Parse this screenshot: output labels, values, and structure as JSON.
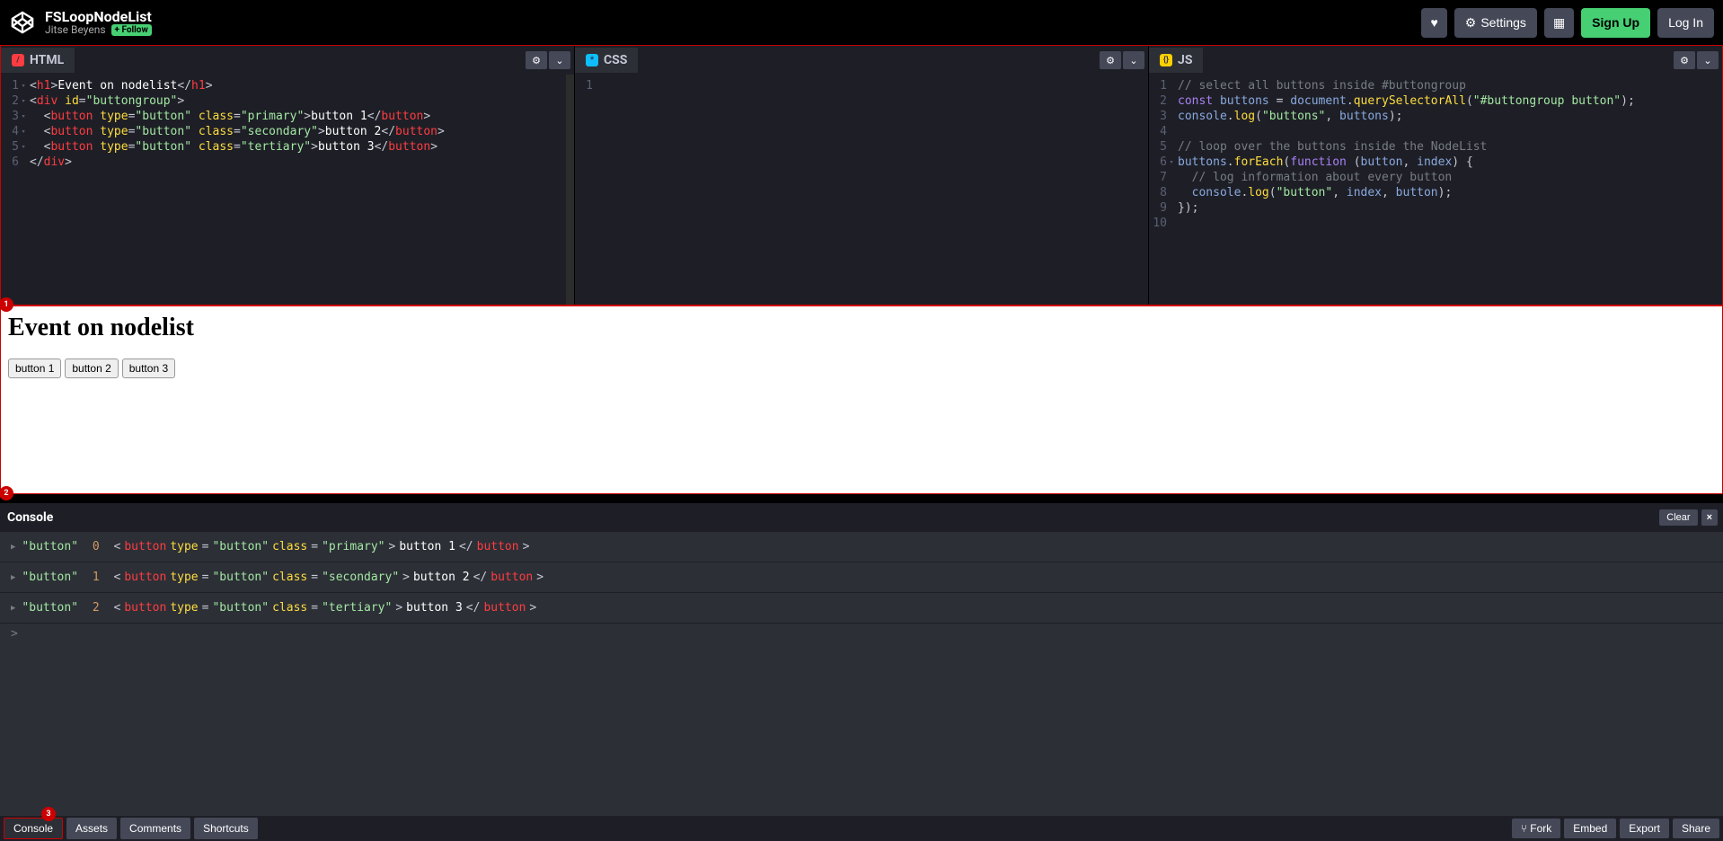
{
  "header": {
    "title": "FSLoopNodeList",
    "author": "Jitse Beyens",
    "follow": "+ Follow",
    "settings": "Settings",
    "signup": "Sign Up",
    "login": "Log In"
  },
  "panes": {
    "html": {
      "label": "HTML"
    },
    "css": {
      "label": "CSS"
    },
    "js": {
      "label": "JS"
    }
  },
  "html_code": {
    "l1": {
      "a": "<",
      "b": "h1",
      "c": ">",
      "d": "Event on nodelist",
      "e": "</",
      "f": "h1",
      "g": ">"
    },
    "l2": {
      "a": "<",
      "b": "div",
      "c": " id",
      "d": "=",
      "e": "\"buttongroup\"",
      "f": ">"
    },
    "l3": {
      "a": "  <",
      "b": "button",
      "c": " type",
      "d": "=",
      "e": "\"button\"",
      "f": " class",
      "g": "=",
      "h": "\"primary\"",
      "i": ">",
      "j": "button 1",
      "k": "</",
      "l": "button",
      "m": ">"
    },
    "l4": {
      "a": "  <",
      "b": "button",
      "c": " type",
      "d": "=",
      "e": "\"button\"",
      "f": " class",
      "g": "=",
      "h": "\"secondary\"",
      "i": ">",
      "j": "button 2",
      "k": "</",
      "l": "button",
      "m": ">"
    },
    "l5": {
      "a": "  <",
      "b": "button",
      "c": " type",
      "d": "=",
      "e": "\"button\"",
      "f": " class",
      "g": "=",
      "h": "\"tertiary\"",
      "i": ">",
      "j": "button 3",
      "k": "</",
      "l": "button",
      "m": ">"
    },
    "l6": {
      "a": "</",
      "b": "div",
      "c": ">"
    }
  },
  "js_code": {
    "l1": "// select all buttons inside #buttongroup",
    "l2": {
      "a": "const",
      "b": " buttons ",
      "c": "=",
      "d": " document",
      "e": ".",
      "f": "querySelectorAll",
      "g": "(",
      "h": "\"#buttongroup button\"",
      "i": ");"
    },
    "l3": {
      "a": "console",
      "b": ".",
      "c": "log",
      "d": "(",
      "e": "\"buttons\"",
      "f": ", ",
      "g": "buttons",
      "h": ");"
    },
    "l5": "// loop over the buttons inside the NodeList",
    "l6": {
      "a": "buttons",
      "b": ".",
      "c": "forEach",
      "d": "(",
      "e": "function",
      "f": " (",
      "g": "button",
      "h": ", ",
      "i": "index",
      "j": ") {"
    },
    "l7": "  // log information about every button",
    "l8": {
      "a": "  console",
      "b": ".",
      "c": "log",
      "d": "(",
      "e": "\"button\"",
      "f": ", ",
      "g": "index",
      "h": ", ",
      "i": "button",
      "j": ");"
    },
    "l9": "});"
  },
  "preview": {
    "heading": "Event on nodelist",
    "b1": "button 1",
    "b2": "button 2",
    "b3": "button 3"
  },
  "console": {
    "title": "Console",
    "clear": "Clear",
    "rows": [
      {
        "pre": "\"button\"",
        "idx": "0",
        "open": "<",
        "tag": "button",
        "attr1": " type",
        "eq1": "=",
        "val1": "\"button\"",
        "attr2": " class",
        "eq2": "=",
        "val2": "\"primary\"",
        "gt": ">",
        "body": "button 1",
        "close1": "</",
        "close2": "button",
        "close3": ">"
      },
      {
        "pre": "\"button\"",
        "idx": "1",
        "open": "<",
        "tag": "button",
        "attr1": " type",
        "eq1": "=",
        "val1": "\"button\"",
        "attr2": " class",
        "eq2": "=",
        "val2": "\"secondary\"",
        "gt": ">",
        "body": "button 2",
        "close1": "</",
        "close2": "button",
        "close3": ">"
      },
      {
        "pre": "\"button\"",
        "idx": "2",
        "open": "<",
        "tag": "button",
        "attr1": " type",
        "eq1": "=",
        "val1": "\"button\"",
        "attr2": " class",
        "eq2": "=",
        "val2": "\"tertiary\"",
        "gt": ">",
        "body": "button 3",
        "close1": "</",
        "close2": "button",
        "close3": ">"
      }
    ],
    "prompt": ">"
  },
  "footer": {
    "console": "Console",
    "assets": "Assets",
    "comments": "Comments",
    "shortcuts": "Shortcuts",
    "fork": "Fork",
    "embed": "Embed",
    "export": "Export",
    "share": "Share"
  },
  "icons": {
    "heart": "♥",
    "gear": "⚙",
    "grid": "▦",
    "chevron": "⌄",
    "fork": "⑂"
  },
  "markers": {
    "m1": "1",
    "m2": "2",
    "m3": "3"
  }
}
